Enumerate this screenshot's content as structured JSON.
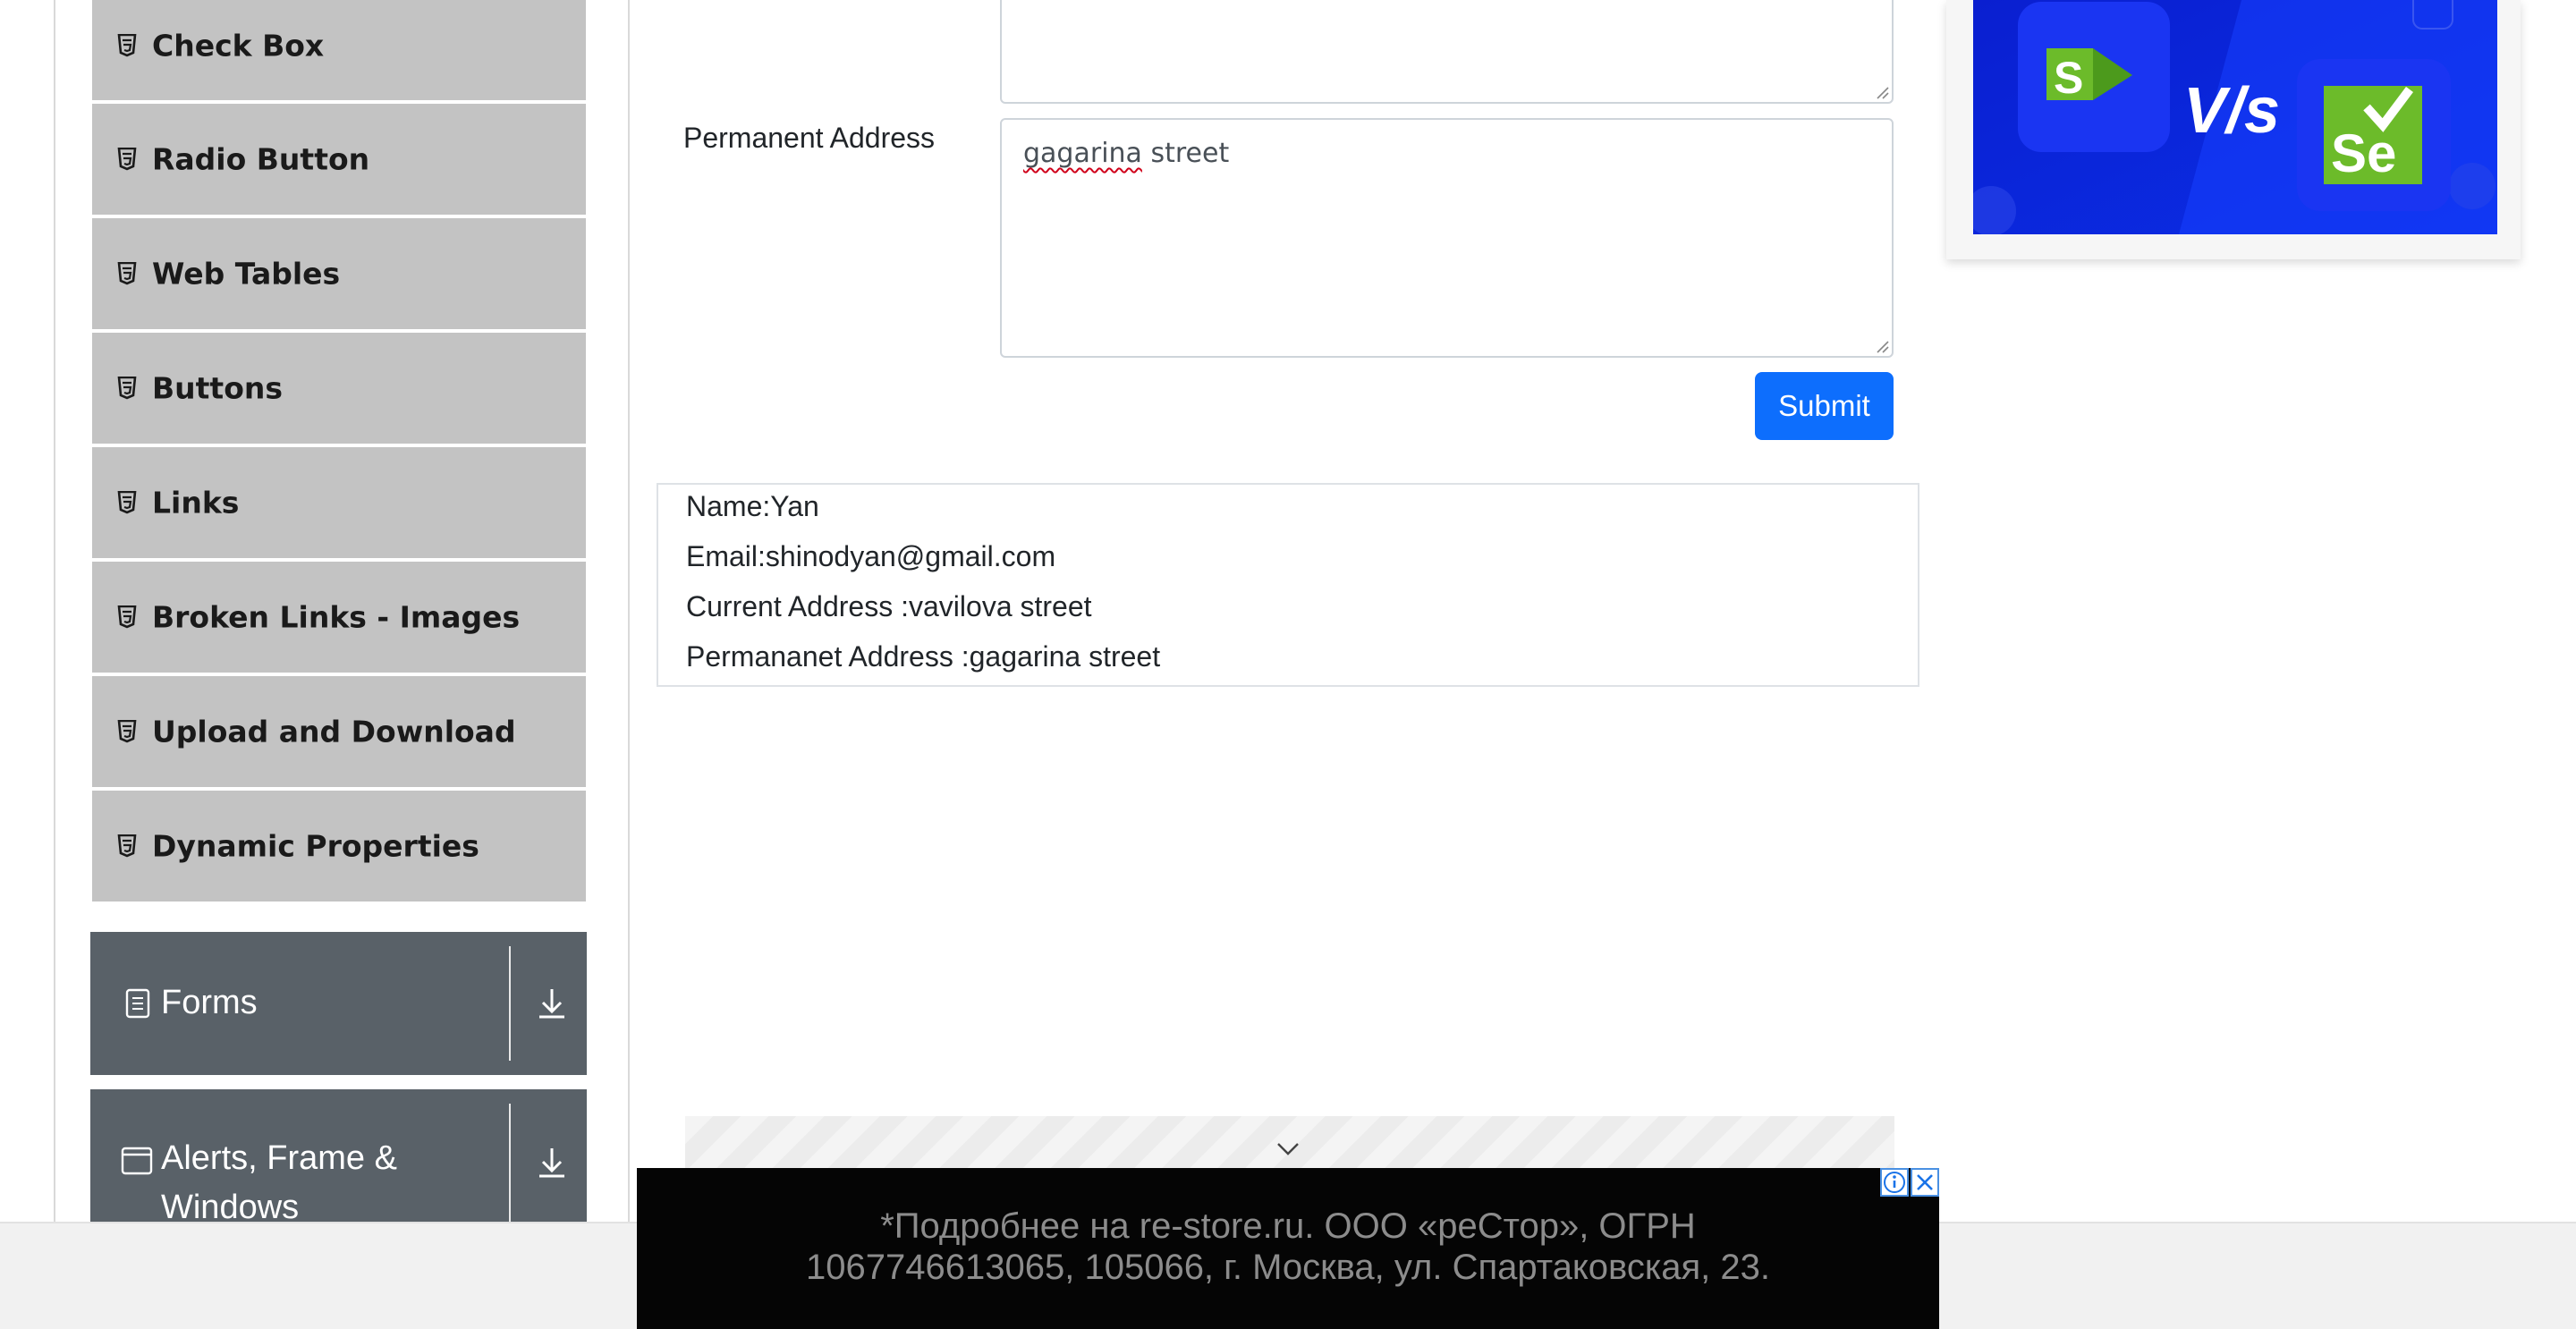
{
  "sidebar": {
    "elements_items": [
      {
        "label": "Check Box"
      },
      {
        "label": "Radio Button"
      },
      {
        "label": "Web Tables"
      },
      {
        "label": "Buttons"
      },
      {
        "label": "Links"
      },
      {
        "label": "Broken Links - Images"
      },
      {
        "label": "Upload and Download"
      },
      {
        "label": "Dynamic Properties"
      }
    ],
    "groups": [
      {
        "label": "Forms",
        "icon": "form-icon"
      },
      {
        "label": "Alerts, Frame & Windows",
        "icon": "window-icon"
      }
    ]
  },
  "form": {
    "permanent_address_label": "Permanent Address",
    "permanent_address_value_word1": "gagarina",
    "permanent_address_value_rest": " street",
    "submit_label": "Submit"
  },
  "output": {
    "name": "Name:Yan",
    "email": "Email:shinodyan@gmail.com",
    "current_address": "Current Address :vavilova street",
    "permanent_address": "Permananet Address :gagarina street"
  },
  "ad_top": {
    "left_logo_letter": "S",
    "vs_text": "V/s",
    "right_logo_letters": "Se",
    "colors": {
      "background": "#0a24d8",
      "green": "#6cbb2a"
    }
  },
  "ad_bottom": {
    "line1": "*Подробнее на re-store.ru. ООО «реСтор», ОГРН",
    "line2": "1067746613065, 105066, г. Москва, ул. Спартаковская, 23."
  },
  "colors": {
    "menu_item_bg": "#c3c3c3",
    "group_bg": "#596168",
    "submit_bg": "#0d6efd"
  }
}
